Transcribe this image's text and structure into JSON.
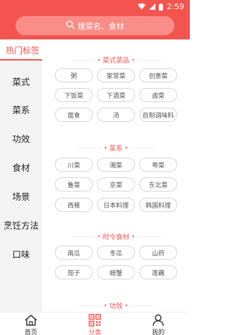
{
  "status_bar": {
    "time": "2:59"
  },
  "search": {
    "placeholder": "搜菜名、食材"
  },
  "hot_tags": {
    "title": "热门标签"
  },
  "sidebar": {
    "items": [
      {
        "label": "菜式"
      },
      {
        "label": "菜系"
      },
      {
        "label": "功效"
      },
      {
        "label": "食材"
      },
      {
        "label": "场景"
      },
      {
        "label": "烹饪方法"
      },
      {
        "label": "口味"
      }
    ]
  },
  "sections": [
    {
      "title": "菜式菜品",
      "tags": [
        "粥",
        "家常菜",
        "创意菜",
        "下饭菜",
        "下酒菜",
        "卤菜",
        "面食",
        "汤",
        "自制调味料"
      ]
    },
    {
      "title": "菜系",
      "tags": [
        "川菜",
        "湘菜",
        "粤菜",
        "鲁菜",
        "京菜",
        "东北菜",
        "西餐",
        "日本料理",
        "韩国料理"
      ]
    },
    {
      "title": "时令食材",
      "tags": [
        "南瓜",
        "冬瓜",
        "山药",
        "茄子",
        "螃蟹",
        "莲藕"
      ]
    },
    {
      "title": "功效",
      "tags": []
    }
  ],
  "bottom_nav": {
    "items": [
      {
        "label": "首页",
        "icon": "home-icon"
      },
      {
        "label": "分类",
        "icon": "category-icon",
        "active": true
      },
      {
        "label": "我的",
        "icon": "profile-icon"
      }
    ]
  },
  "colors": {
    "accent": "#f4544f",
    "search_bg": "#fb8d89",
    "sidebar_bg": "#f3f3f3"
  }
}
